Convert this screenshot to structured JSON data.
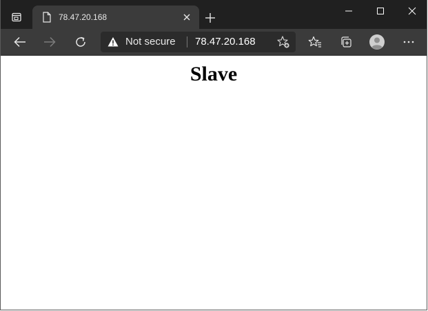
{
  "window": {
    "tab": {
      "title": "78.47.20.168",
      "favicon": "page-icon"
    },
    "controls": [
      "minimize-icon",
      "maximize-icon",
      "close-icon"
    ]
  },
  "toolbar": {
    "back_icon": "arrow-left-icon",
    "forward_icon": "arrow-right-icon",
    "refresh_icon": "refresh-icon",
    "address": {
      "security_label": "Not secure",
      "url": "78.47.20.168"
    },
    "right_icons": [
      "favorites-icon",
      "collections-icon",
      "profile-icon",
      "more-icon"
    ]
  },
  "page": {
    "heading": "Slave"
  },
  "colors": {
    "titlebar": "#202020",
    "toolbar": "#3b3b3b",
    "addressbar": "#2b2b2b",
    "page_background": "#ffffff"
  }
}
